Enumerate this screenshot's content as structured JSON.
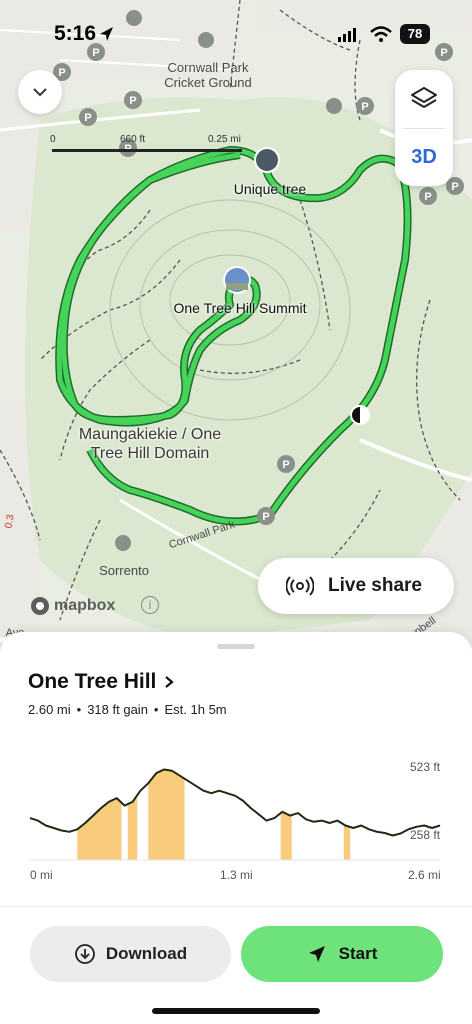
{
  "status_bar": {
    "time": "5:16",
    "battery": "78"
  },
  "map": {
    "scale": {
      "left": "0",
      "mid": "660 ft",
      "right": "0.25 mi"
    },
    "three_d_label": "3D",
    "labels": {
      "cricket_ground": "Cornwall Park\nCricket Ground",
      "unique_tree": "Unique tree",
      "summit": "One Tree Hill Summit",
      "domain": "Maungakiekie / One\nTree Hill Domain",
      "sorrento": "Sorrento",
      "cornwall_park_road": "Cornwall Park",
      "campbell_road": "Campbell",
      "ave": "Ave",
      "edge_marker": "0.3"
    },
    "live_share_label": "Live share",
    "attribution": "mapbox",
    "colors": {
      "route": "#46d35a",
      "map_bg": "#e9ede4",
      "park": "#dbe7cf"
    }
  },
  "trail": {
    "name": "One Tree Hill",
    "distance": "2.60 mi",
    "gain": "318 ft gain",
    "estimate": "Est. 1h 5m"
  },
  "chart_data": {
    "type": "area",
    "x_unit": "mi",
    "y_unit": "ft",
    "xlim": [
      0,
      2.6
    ],
    "x_ticks": [
      "0 mi",
      "1.3 mi",
      "2.6 mi"
    ],
    "y_ticks": [
      "523 ft",
      "258 ft"
    ],
    "ylim": [
      258,
      523
    ],
    "elevation_series": {
      "x": [
        0,
        0.05,
        0.1,
        0.15,
        0.2,
        0.25,
        0.3,
        0.35,
        0.4,
        0.45,
        0.5,
        0.55,
        0.6,
        0.65,
        0.7,
        0.75,
        0.8,
        0.85,
        0.9,
        0.95,
        1.0,
        1.05,
        1.1,
        1.15,
        1.2,
        1.25,
        1.3,
        1.35,
        1.4,
        1.45,
        1.5,
        1.55,
        1.6,
        1.65,
        1.7,
        1.75,
        1.8,
        1.85,
        1.9,
        1.95,
        2.0,
        2.05,
        2.1,
        2.15,
        2.2,
        2.25,
        2.3,
        2.35,
        2.4,
        2.45,
        2.5,
        2.55,
        2.6
      ],
      "y": [
        330,
        320,
        300,
        290,
        280,
        275,
        285,
        310,
        340,
        370,
        395,
        410,
        380,
        395,
        440,
        470,
        510,
        525,
        520,
        500,
        480,
        460,
        440,
        430,
        440,
        430,
        420,
        400,
        370,
        345,
        320,
        330,
        355,
        340,
        350,
        325,
        315,
        320,
        310,
        320,
        300,
        290,
        300,
        285,
        275,
        270,
        260,
        268,
        285,
        295,
        300,
        290,
        300
      ]
    },
    "steep_segments_mi": [
      [
        0.3,
        0.58
      ],
      [
        0.62,
        0.68
      ],
      [
        0.75,
        0.98
      ],
      [
        1.59,
        1.66
      ],
      [
        1.99,
        2.03
      ]
    ],
    "colors": {
      "line": "#1f2a14",
      "steep_fill": "#f9cb7c"
    }
  },
  "actions": {
    "download_label": "Download",
    "start_label": "Start"
  }
}
